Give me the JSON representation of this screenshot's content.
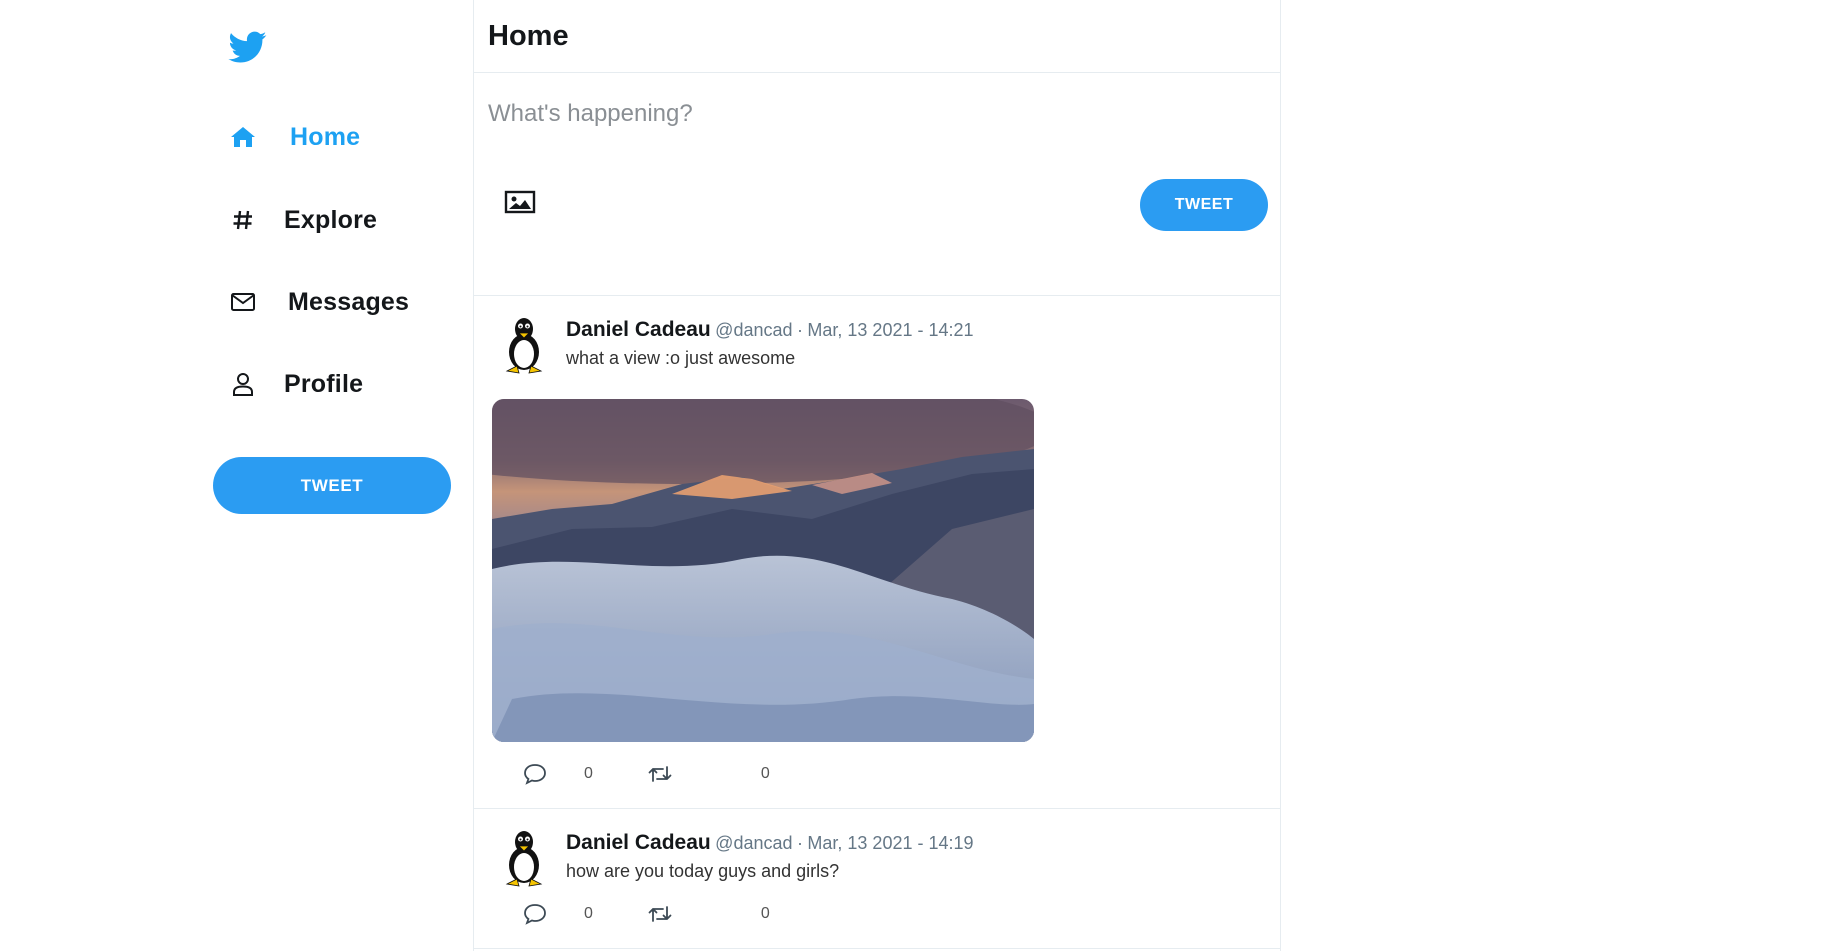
{
  "sidebar": {
    "logo": "twitter-bird-icon",
    "items": [
      {
        "label": "Home",
        "icon": "home-icon",
        "active": true
      },
      {
        "label": "Explore",
        "icon": "hashtag-icon",
        "active": false
      },
      {
        "label": "Messages",
        "icon": "envelope-icon",
        "active": false
      },
      {
        "label": "Profile",
        "icon": "user-icon",
        "active": false
      }
    ],
    "tweet_button": "TWEET"
  },
  "header": {
    "title": "Home"
  },
  "compose": {
    "placeholder": "What's happening?",
    "media_icon": "image-icon",
    "tweet_button": "TWEET"
  },
  "tweets": [
    {
      "name": "Daniel Cadeau",
      "handle": "@dancad",
      "separator": "·",
      "date": "Mar, 13 2021 - 14:21",
      "text": "what a view :o just awesome",
      "image": "mountain-clouds-photo",
      "replies": "0",
      "retweets": "0"
    },
    {
      "name": "Daniel Cadeau",
      "handle": "@dancad",
      "separator": "·",
      "date": "Mar, 13 2021 - 14:19",
      "text": "how are you today guys and girls?",
      "replies": "0",
      "retweets": "0"
    }
  ],
  "colors": {
    "accent": "#1da1f2",
    "button": "#2b9cf2",
    "border": "#e6ecf0",
    "muted": "#657786"
  }
}
